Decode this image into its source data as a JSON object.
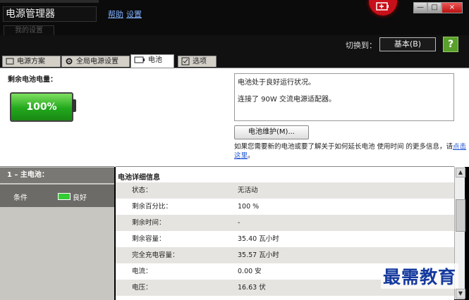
{
  "window": {
    "title": "电源管理器",
    "links": [
      "帮助",
      "设置"
    ],
    "ghost_button": "我的设置"
  },
  "window_controls": [
    "—",
    "□",
    "×"
  ],
  "switch": {
    "label": "切换到：",
    "mode": "基本(B)",
    "help": "?"
  },
  "tabs": [
    {
      "label": "电源方案",
      "icon": "page-icon"
    },
    {
      "label": "全局电源设置",
      "icon": "gear-icon"
    },
    {
      "label": "电池",
      "icon": "battery-icon",
      "active": true
    },
    {
      "label": "选项",
      "icon": "checkbox-icon"
    }
  ],
  "battery": {
    "remaining_label": "剩余电池电量：",
    "percent": "100%",
    "level": 1.0
  },
  "status": {
    "line1": "电池处于良好运行状况。",
    "line2": "连接了 90W 交流电源适配器。"
  },
  "maintenance_button": "电池维护(M)...",
  "info": {
    "text": "如果您需要新的电池或要了解关于如何延长电池 使用时间 的更多信息，请",
    "link": "点击这里",
    "suffix": "。"
  },
  "left": {
    "header": "1 – 主电池：",
    "condition_label": "条件",
    "condition_value": "良好"
  },
  "details": {
    "title": "电池详细信息",
    "rows": [
      {
        "key": "状态：",
        "value": "无活动"
      },
      {
        "key": "剩余百分比：",
        "value": "100 %"
      },
      {
        "key": "剩余时间：",
        "value": "-"
      },
      {
        "key": "剩余容量：",
        "value": "35.40 瓦小时"
      },
      {
        "key": "完全充电容量：",
        "value": "35.57 瓦小时"
      },
      {
        "key": "电流：",
        "value": "0.00 安"
      },
      {
        "key": "电压：",
        "value": "16.63 伏"
      }
    ]
  },
  "watermark": "最需教育",
  "colors": {
    "battery_green": "#22a81c",
    "brand_red": "#c8101a",
    "link_blue": "#1a4fd0"
  }
}
